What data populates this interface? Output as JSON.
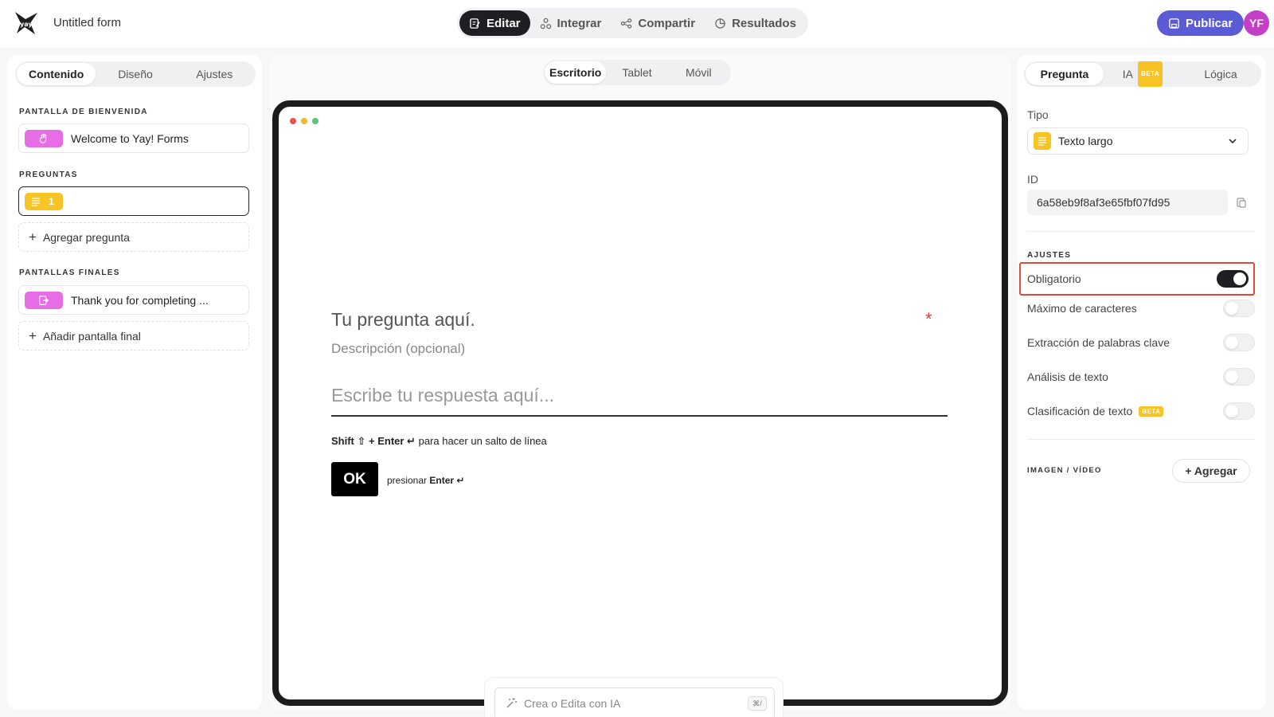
{
  "app": {
    "form_title": "Untitled form",
    "avatar_initials": "YF",
    "publish_label": "Publicar"
  },
  "nav": [
    {
      "label": "Editar",
      "active": true,
      "icon": "edit-icon"
    },
    {
      "label": "Integrar",
      "icon": "integrate-icon"
    },
    {
      "label": "Compartir",
      "icon": "share-icon"
    },
    {
      "label": "Resultados",
      "icon": "results-icon"
    }
  ],
  "left": {
    "tabs": [
      "Contenido",
      "Diseño",
      "Ajustes"
    ],
    "welcome_label": "PANTALLA DE BIENVENIDA",
    "welcome_item": "Welcome to Yay! Forms",
    "questions_label": "PREGUNTAS",
    "question_number": "1",
    "add_question": "Agregar pregunta",
    "end_label": "PANTALLAS FINALES",
    "end_item": "Thank you for completing ...",
    "add_end": "Añadir pantalla final"
  },
  "center": {
    "tabs": [
      "Escritorio",
      "Tablet",
      "Móvil"
    ],
    "question_title": "Tu pregunta aquí.",
    "required_mark": "*",
    "description": "Descripción (opcional)",
    "answer_placeholder": "Escribe tu respuesta aquí...",
    "hint_shift": "Shift ⇧",
    "hint_enter": "+ Enter ↵",
    "hint_rest": "para hacer un salto de línea",
    "ok_label": "OK",
    "press_prefix": "presionar",
    "press_key": "Enter ↵",
    "ai_placeholder": "Crea o Edita con IA",
    "ai_shortcut": "⌘/"
  },
  "right": {
    "tabs": [
      "Pregunta",
      "IA",
      "Lógica"
    ],
    "beta": "BETA",
    "type_label": "Tipo",
    "type_value": "Texto largo",
    "id_label": "ID",
    "id_value": "6a58eb9f8af3e65fbf07fd95",
    "settings_label": "AJUSTES",
    "settings": [
      {
        "label": "Obligatorio",
        "on": true
      },
      {
        "label": "Máximo de caracteres",
        "on": false
      },
      {
        "label": "Extracción de palabras clave",
        "on": false
      },
      {
        "label": "Análisis de texto",
        "on": false
      },
      {
        "label": "Clasificación de texto",
        "on": false
      }
    ],
    "media_label": "IMAGEN / VÍDEO",
    "media_add": "+ Agregar"
  },
  "colors": {
    "accent": "#5b5bd6",
    "highlight": "#e04b3a",
    "yellow": "#f7c325",
    "pink": "#e66de6"
  }
}
